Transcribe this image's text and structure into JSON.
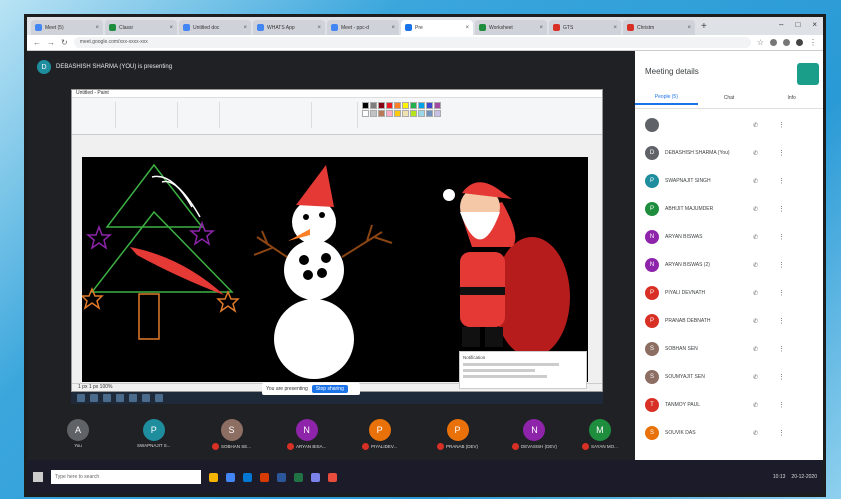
{
  "browser": {
    "tabs": [
      {
        "title": "Meet (5)",
        "color": "#4285f4"
      },
      {
        "title": "Classr",
        "color": "#1e8e3e"
      },
      {
        "title": "Untitled doc",
        "color": "#4285f4"
      },
      {
        "title": "WHATS App",
        "color": "#4285f4"
      },
      {
        "title": "Meet - ppc-d",
        "color": "#4285f4"
      },
      {
        "title": "Pre",
        "color": "#1a73e8"
      },
      {
        "title": "Worksheet",
        "color": "#1e8e3e"
      },
      {
        "title": "GTS",
        "color": "#d93025"
      },
      {
        "title": "Christm",
        "color": "#d93025"
      }
    ],
    "new_tab": "+",
    "url": "meet.google.com/xxx-xxxx-xxx",
    "window_controls": [
      "–",
      "□",
      "×"
    ]
  },
  "meet": {
    "presenter_initial": "D",
    "presenter_label": "DEBASHISH SHARMA (YOU) is presenting"
  },
  "paint": {
    "title": "Untitled - Paint",
    "menu": "File   Home   View",
    "status": "1 px        1 px        100%",
    "palette": [
      "#000000",
      "#7f7f7f",
      "#880015",
      "#ed1c24",
      "#ff7f27",
      "#fff200",
      "#22b14c",
      "#00a2e8",
      "#3f48cc",
      "#a349a4",
      "#ffffff",
      "#c3c3c3",
      "#b97a57",
      "#ffaec9",
      "#ffc90e",
      "#efe4b0",
      "#b5e61d",
      "#99d9ea",
      "#7092be",
      "#c8bfe7"
    ]
  },
  "stop_presenting": {
    "text": "You are presenting",
    "button": "Stop sharing"
  },
  "notification": {
    "title": "Notification"
  },
  "tiles": [
    {
      "initial": "A",
      "color": "#5f6368",
      "name": "You",
      "mic_off": false
    },
    {
      "initial": "P",
      "color": "#1e8e9e",
      "name": "SWAPNAJIT S...",
      "mic_off": false
    },
    {
      "initial": "S",
      "color": "#8d6e63",
      "name": "SOBHAN SE...",
      "mic_off": true
    },
    {
      "initial": "N",
      "color": "#8e24aa",
      "name": "ARYAN BISA...",
      "mic_off": true
    },
    {
      "initial": "P",
      "color": "#e8710a",
      "name": "PIYALIDEV...",
      "mic_off": true
    },
    {
      "initial": "P",
      "color": "#e8710a",
      "name": "PRANAB (DEV)",
      "mic_off": true
    },
    {
      "initial": "N",
      "color": "#8e24aa",
      "name": "DEVASISH (DEV)",
      "mic_off": true
    },
    {
      "initial": "M",
      "color": "#1e8e3e",
      "name": "SAYAN MO...",
      "mic_off": true
    }
  ],
  "side_panel": {
    "title": "Meeting details",
    "tabs": [
      "People (5)",
      "Chat",
      "Info"
    ],
    "people": [
      {
        "initial": "",
        "color": "#5f6368",
        "name": ""
      },
      {
        "initial": "D",
        "color": "#5f6368",
        "name": "DEBASHISH SHARMA (You)"
      },
      {
        "initial": "P",
        "color": "#1e8e9e",
        "name": "SWAPNAJIT SINGH"
      },
      {
        "initial": "P",
        "color": "#1e8e3e",
        "name": "ABHIJIT MAJUMDER"
      },
      {
        "initial": "N",
        "color": "#8e24aa",
        "name": "ARYAN BISWAS"
      },
      {
        "initial": "N",
        "color": "#8e24aa",
        "name": "ARYAN BISWAS (2)"
      },
      {
        "initial": "P",
        "color": "#d93025",
        "name": "PIYALI DEVNATH"
      },
      {
        "initial": "P",
        "color": "#d93025",
        "name": "PRANAB DEBNATH"
      },
      {
        "initial": "S",
        "color": "#8d6e63",
        "name": "SOBHAN SEN"
      },
      {
        "initial": "S",
        "color": "#8d6e63",
        "name": "SOUMYAJIT SEN"
      },
      {
        "initial": "T",
        "color": "#d93025",
        "name": "TANMOY PAUL"
      },
      {
        "initial": "S",
        "color": "#e8710a",
        "name": "SOUVIK DAS"
      }
    ]
  },
  "taskbar": {
    "search": "Type here to search",
    "time": "10:13",
    "date": "20-12-2020"
  }
}
